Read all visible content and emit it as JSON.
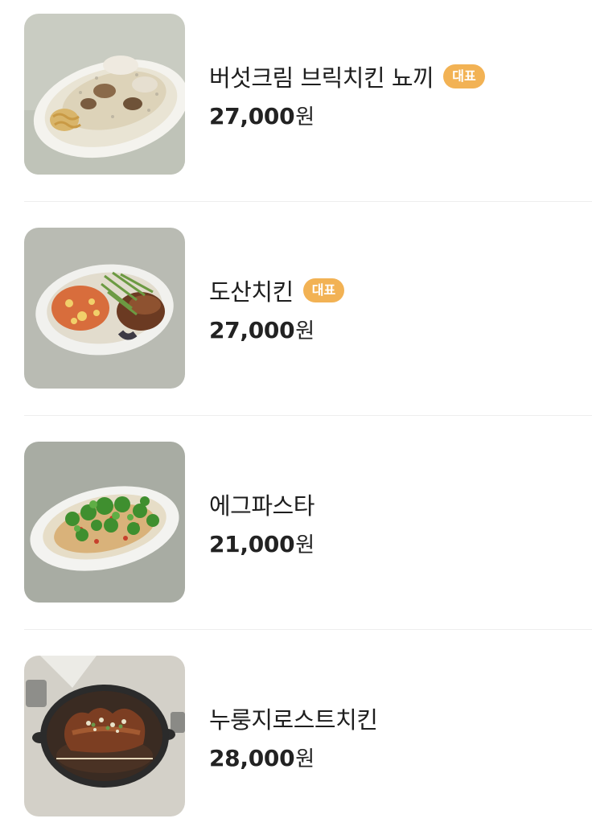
{
  "menu": {
    "items": [
      {
        "name": "버섯크림 브릭치킨 뇨끼",
        "badge": "대표",
        "price": "27,000",
        "currency": "원",
        "image": "mushroom-cream-chicken-gnocchi-photo"
      },
      {
        "name": "도산치킨",
        "badge": "대표",
        "price": "27,000",
        "currency": "원",
        "image": "dosan-chicken-photo"
      },
      {
        "name": "에그파스타",
        "badge": "",
        "price": "21,000",
        "currency": "원",
        "image": "egg-pasta-photo"
      },
      {
        "name": "누룽지로스트치킨",
        "badge": "",
        "price": "28,000",
        "currency": "원",
        "image": "nurungji-roast-chicken-photo"
      }
    ]
  },
  "colors": {
    "badge_bg": "#f2b254",
    "divider": "#eeeeee",
    "text": "#1e1e1e"
  }
}
